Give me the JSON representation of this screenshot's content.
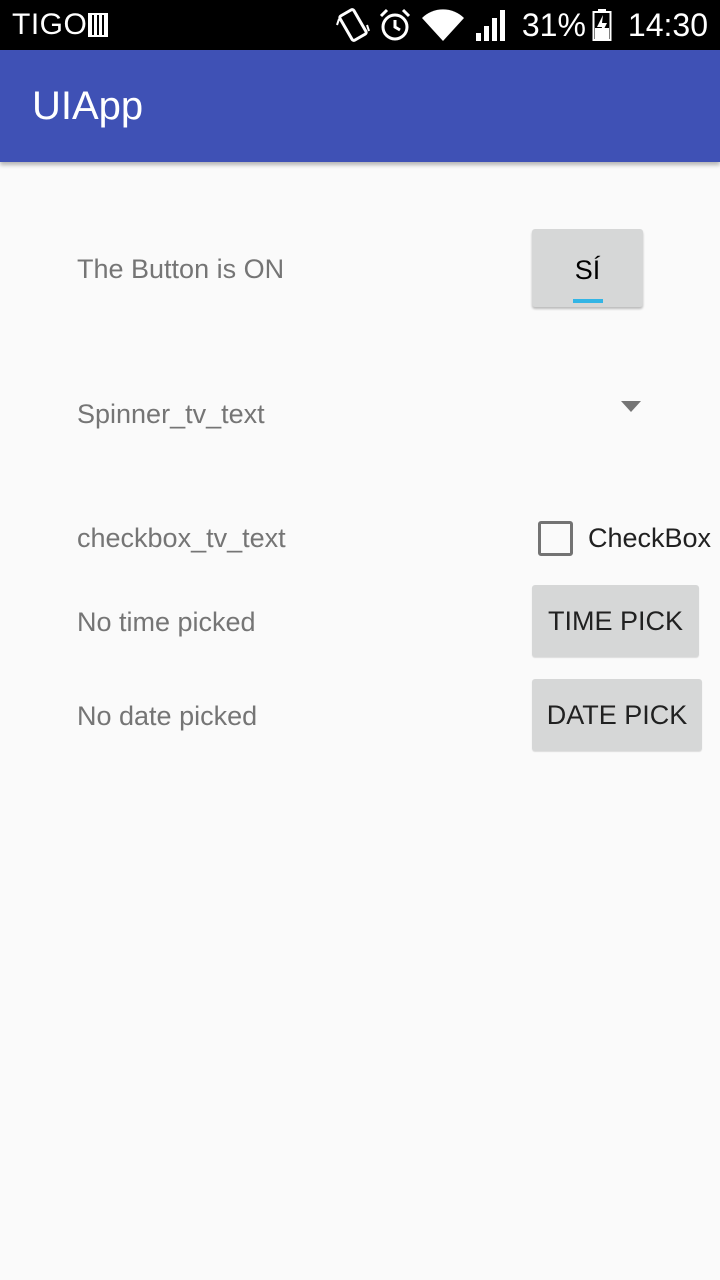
{
  "status_bar": {
    "carrier": "TIGO",
    "battery_percent": "31%",
    "time": "14:30",
    "icons": [
      "sim-card-icon",
      "vibrate-icon",
      "alarm-icon",
      "wifi-icon",
      "signal-icon",
      "battery-charging-icon"
    ]
  },
  "app_bar": {
    "title": "UIApp",
    "color": "#3f51b5"
  },
  "toggle_row": {
    "label": "The Button is ON",
    "button_label": "SÍ",
    "indicator_color": "#33b5e5"
  },
  "spinner_row": {
    "label": "Spinner_tv_text"
  },
  "checkbox_row": {
    "label": "checkbox_tv_text",
    "checkbox_label": "CheckBox",
    "checked": false
  },
  "time_row": {
    "label": "No time picked",
    "button_label": "TIME PICK"
  },
  "date_row": {
    "label": "No date picked",
    "button_label": "DATE PICK"
  }
}
